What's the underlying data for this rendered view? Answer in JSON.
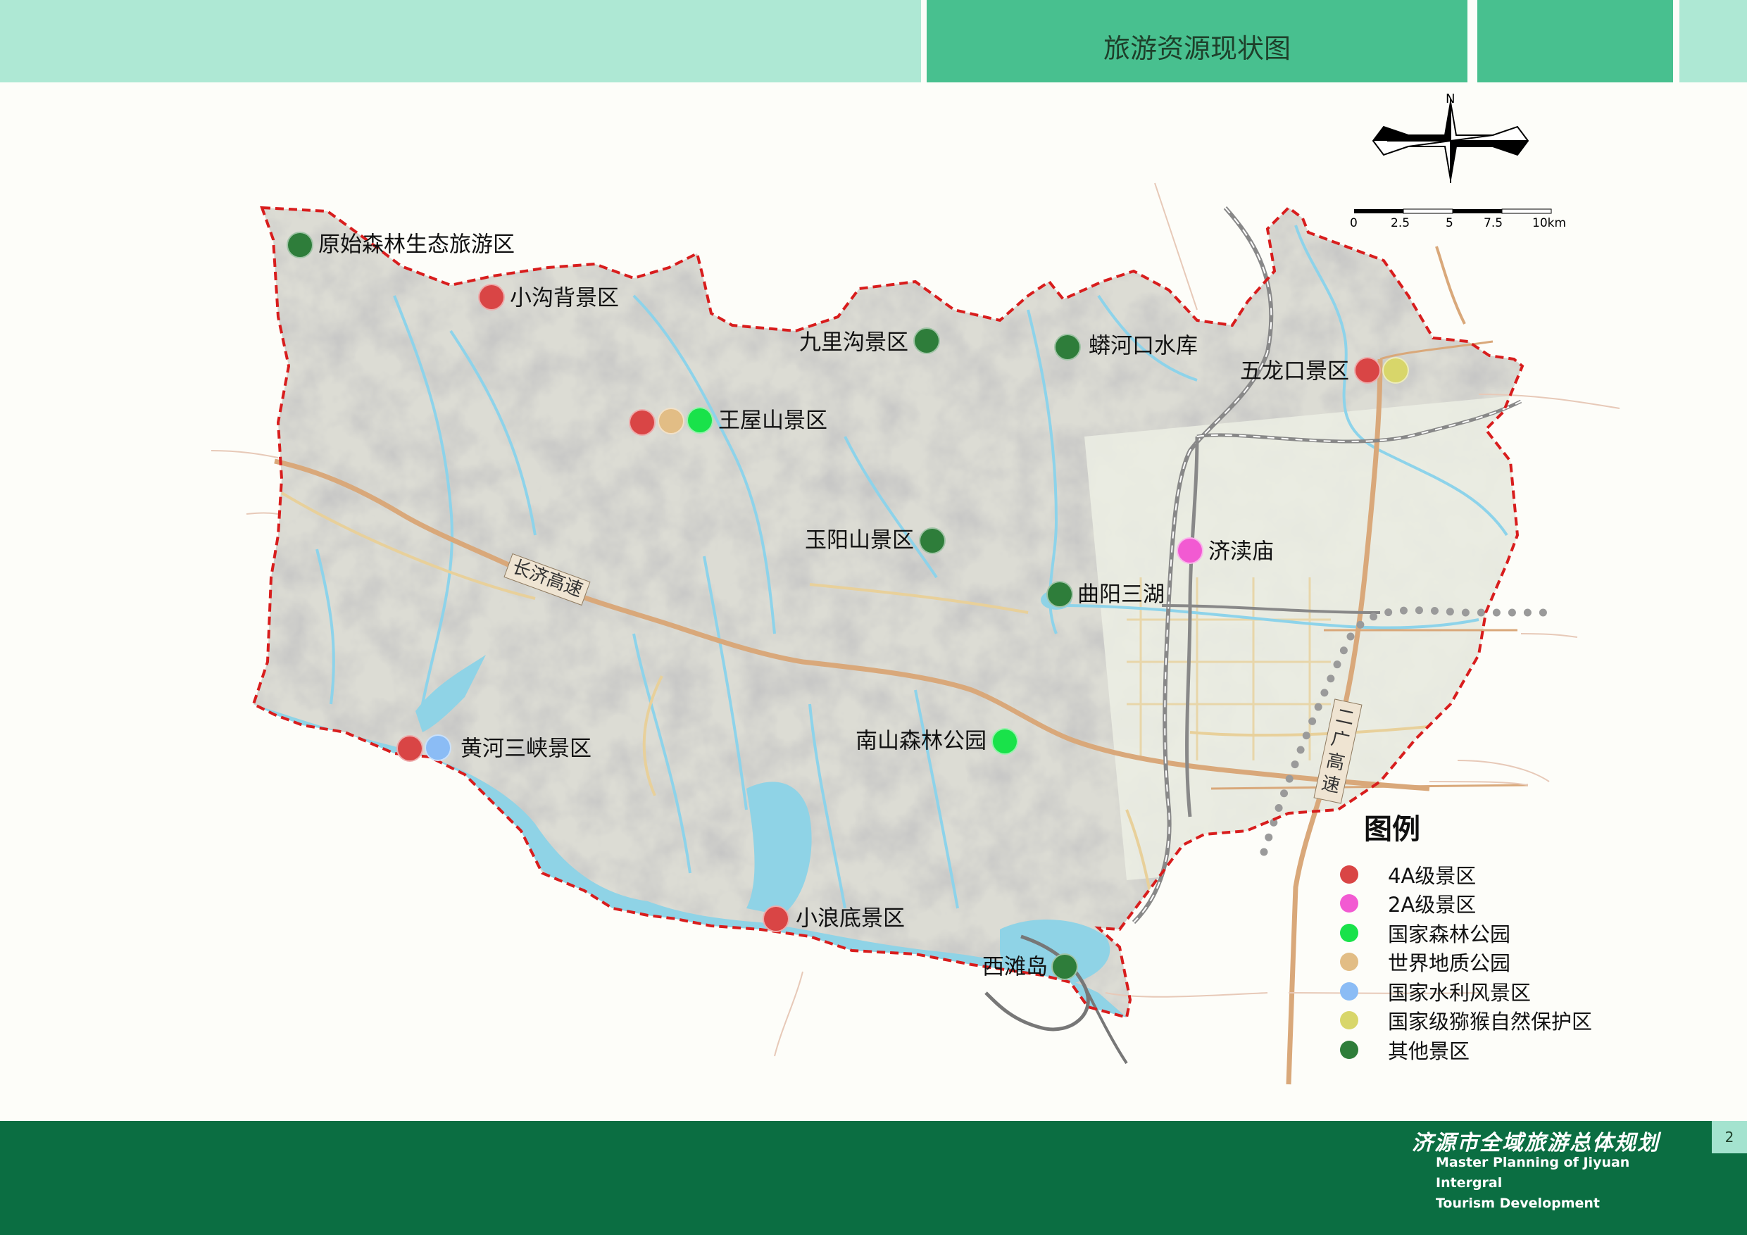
{
  "header": {
    "title": "旅游资源现状图",
    "colors": {
      "light": "#aee8d4",
      "mid": "#48c08f"
    }
  },
  "map": {
    "road_labels": {
      "changji": "长济高速",
      "erguang": "二广高速"
    },
    "scale_bar": {
      "ticks": [
        "0",
        "2.5",
        "5",
        "7.5",
        "10km"
      ]
    },
    "north_label": "N",
    "spots": [
      {
        "name": "原始森林生态旅游区",
        "category": "other",
        "color": "#2e7d3a"
      },
      {
        "name": "小沟背景区",
        "category": "4a",
        "color": "#d94545"
      },
      {
        "name": "九里沟景区",
        "category": "other",
        "color": "#2e7d3a"
      },
      {
        "name": "蟒河口水库",
        "category": "other",
        "color": "#2e7d3a"
      },
      {
        "name": "五龙口景区",
        "category": "4a+macaque",
        "colors": [
          "#d94545",
          "#d8d66a"
        ]
      },
      {
        "name": "王屋山景区",
        "category": "4a+geopark+forest",
        "colors": [
          "#d94545",
          "#e2bd85",
          "#19e24a"
        ]
      },
      {
        "name": "玉阳山景区",
        "category": "other",
        "color": "#2e7d3a"
      },
      {
        "name": "济渎庙",
        "category": "2a",
        "color": "#f25ad2"
      },
      {
        "name": "曲阳三湖",
        "category": "other",
        "color": "#2e7d3a"
      },
      {
        "name": "南山森林公园",
        "category": "forest",
        "color": "#19e24a"
      },
      {
        "name": "黄河三峡景区",
        "category": "4a+water",
        "colors": [
          "#d94545",
          "#8bbcf5"
        ]
      },
      {
        "name": "小浪底景区",
        "category": "4a",
        "color": "#d94545"
      },
      {
        "name": "西滩岛",
        "category": "other",
        "color": "#2e7d3a"
      }
    ]
  },
  "legend": {
    "title": "图例",
    "items": [
      {
        "label": "4A级景区",
        "color": "#d94545"
      },
      {
        "label": "2A级景区",
        "color": "#f25ad2"
      },
      {
        "label": "国家森林公园",
        "color": "#19e24a"
      },
      {
        "label": "世界地质公园",
        "color": "#e2bd85"
      },
      {
        "label": "国家水利风景区",
        "color": "#8bbcf5"
      },
      {
        "label": "国家级猕猴自然保护区",
        "color": "#d8d66a"
      },
      {
        "label": "其他景区",
        "color": "#2e7d3a"
      }
    ]
  },
  "footer": {
    "title_cn": "济源市全域旅游总体规划",
    "title_en_1": "Master Planning of Jiyuan Intergral",
    "title_en_2": "Tourism Development",
    "page_number": "2",
    "color": "#0b6e42"
  }
}
